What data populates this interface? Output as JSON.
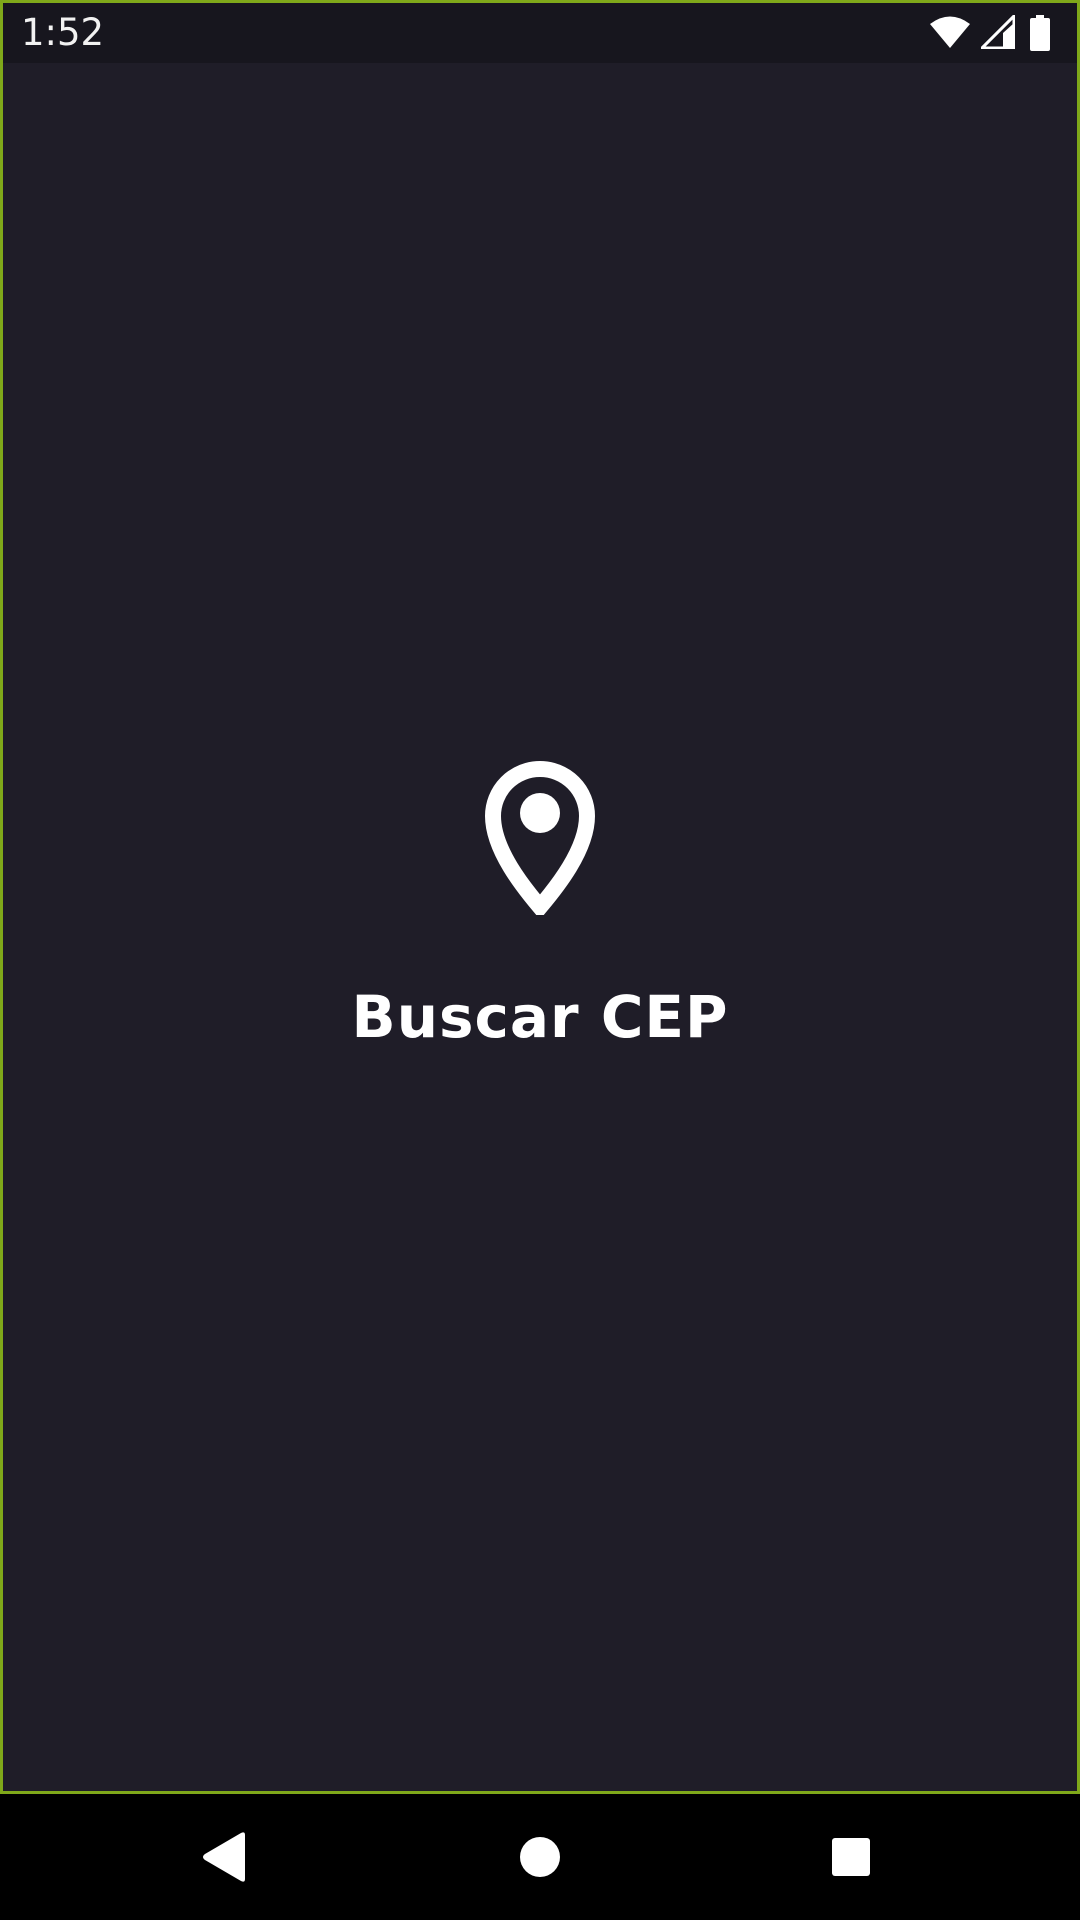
{
  "status_bar": {
    "time": "1:52",
    "icons": [
      "wifi-icon",
      "signal-icon",
      "battery-icon"
    ]
  },
  "splash": {
    "icon": "location-pin-icon",
    "title": "Buscar CEP"
  },
  "navigation_bar": {
    "buttons": [
      "back-icon",
      "home-icon",
      "recents-icon"
    ]
  },
  "colors": {
    "background": "#1f1d28",
    "status_bar": "#17161e",
    "foreground": "#ffffff",
    "border_accent": "#7fa81a",
    "nav_bar": "#000000"
  }
}
